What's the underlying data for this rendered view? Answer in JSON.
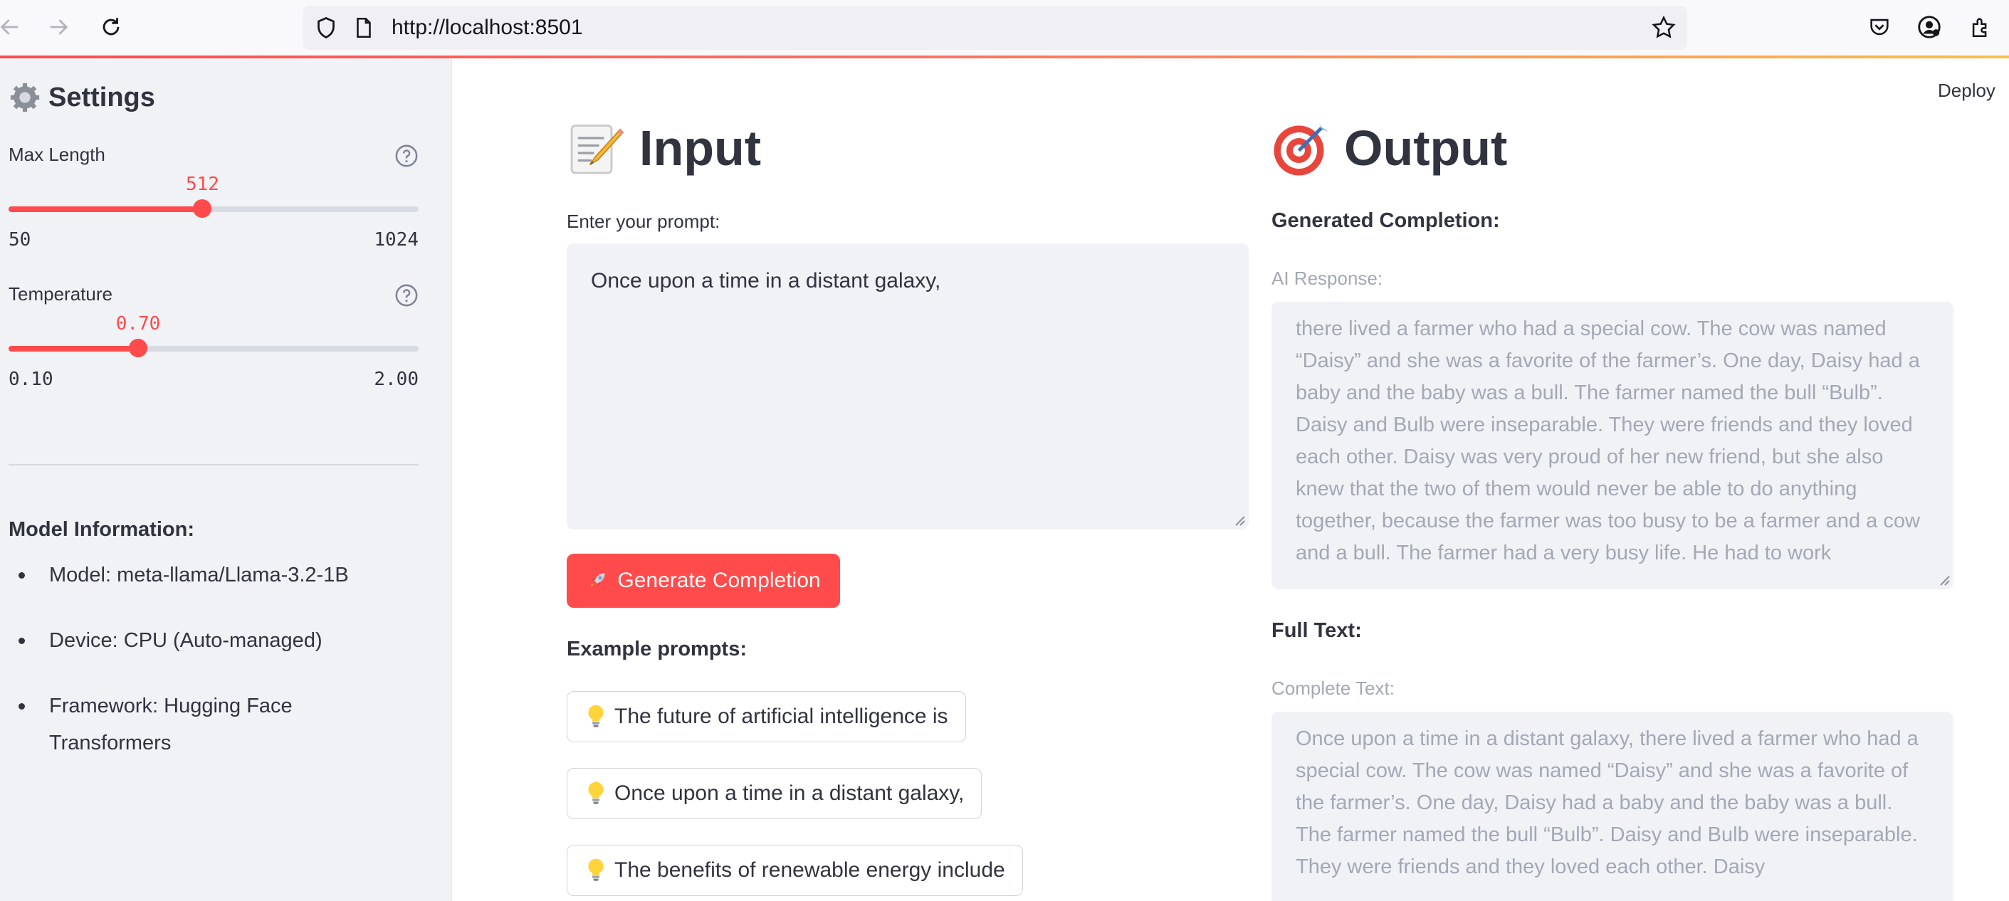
{
  "browser": {
    "url": "http://localhost:8501"
  },
  "sidebar": {
    "title": "Settings",
    "sliders": [
      {
        "label": "Max Length",
        "value": "512",
        "min": "50",
        "max": "1024",
        "fraction": 0.473
      },
      {
        "label": "Temperature",
        "value": "0.70",
        "min": "0.10",
        "max": "2.00",
        "fraction": 0.316
      }
    ],
    "model_info_title": "Model Information:",
    "model_info": [
      "Model: meta-llama/Llama-3.2-1B",
      "Device: CPU (Auto-managed)",
      "Framework: Hugging Face Transformers"
    ]
  },
  "header": {
    "deploy_label": "Deploy"
  },
  "input": {
    "title": "Input",
    "prompt_label": "Enter your prompt:",
    "prompt_value": "Once upon a time in a distant galaxy,",
    "generate_button": "Generate Completion",
    "examples_title": "Example prompts:",
    "examples": [
      "The future of artificial intelligence is",
      "Once upon a time in a distant galaxy,",
      "The benefits of renewable energy include"
    ]
  },
  "output": {
    "title": "Output",
    "generated_heading": "Generated Completion:",
    "response_label": "AI Response:",
    "response_text": "there lived a farmer who had a special cow. The cow was named “Daisy” and she was a favorite of the farmer’s. One day, Daisy had a baby and the baby was a bull. The farmer named the bull “Bulb”. Daisy and Bulb were inseparable. They were friends and they loved each other. Daisy was very proud of her new friend, but she also knew that the two of them would never be able to do anything together, because the farmer was too busy to be a farmer and a cow and a bull. The farmer had a very busy life. He had to work",
    "full_heading": "Full Text:",
    "complete_label": "Complete Text:",
    "complete_text": "Once upon a time in a distant galaxy, there lived a farmer who had a special cow. The cow was named “Daisy” and she was a favorite of the farmer’s. One day, Daisy had a baby and the baby was a bull. The farmer named the bull “Bulb”. Daisy and Bulb were inseparable. They were friends and they loved each other. Daisy"
  },
  "colors": {
    "accent": "#ff4b4b",
    "sidebar_bg": "#f0f2f6",
    "text": "#31333f",
    "muted": "#a3a8b4"
  },
  "icons": [
    "back-arrow-icon",
    "forward-arrow-icon",
    "reload-icon",
    "shield-icon",
    "page-icon",
    "star-icon",
    "pocket-icon",
    "account-icon",
    "extensions-icon",
    "gear-icon",
    "help-icon",
    "memo-icon",
    "target-icon",
    "rocket-icon",
    "bulb-icon"
  ]
}
